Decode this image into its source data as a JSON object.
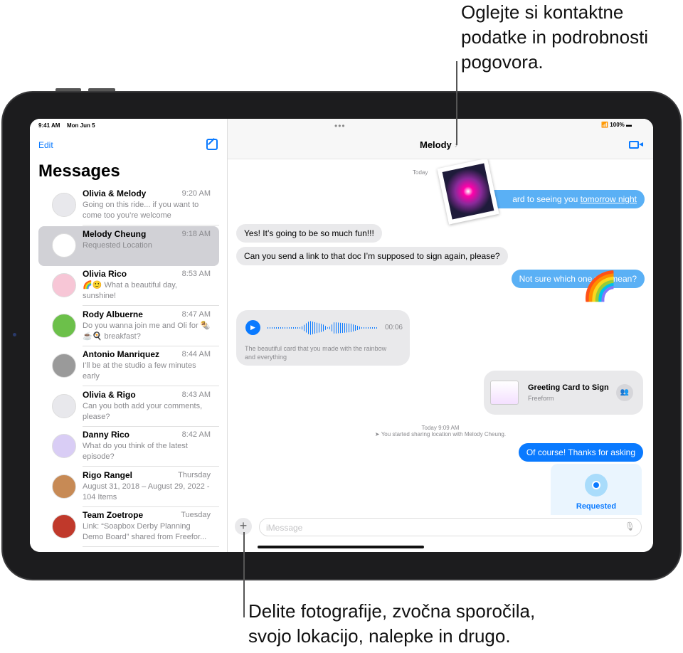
{
  "callouts": {
    "top": [
      "Oglejte si kontaktne",
      "podatke in podrobnosti",
      "pogovora."
    ],
    "bottom": [
      "Delite fotografije, zvočna sporočila,",
      "svojo lokacijo, nalepke in drugo."
    ]
  },
  "status": {
    "time": "9:41 AM",
    "date": "Mon Jun 5",
    "battery": "100%"
  },
  "sidebar": {
    "edit": "Edit",
    "title": "Messages",
    "items": [
      {
        "name": "Olivia & Melody",
        "time": "9:20 AM",
        "preview": "Going on this ride... if you want to come too you’re welcome",
        "avatar": "#e8e8ec"
      },
      {
        "name": "Melody Cheung",
        "time": "9:18 AM",
        "preview": "Requested Location",
        "avatar": "#ffffff",
        "selected": true
      },
      {
        "name": "Olivia Rico",
        "time": "8:53 AM",
        "preview": "🌈🙂 What a beautiful day, sunshine!",
        "avatar": "#f7c6d6"
      },
      {
        "name": "Rody Albuerne",
        "time": "8:47 AM",
        "preview": "Do you wanna join me and Oli for 🌯☕🍳 breakfast?",
        "avatar": "#6cc04a"
      },
      {
        "name": "Antonio Manriquez",
        "time": "8:44 AM",
        "preview": "I’ll be at the studio a few minutes early",
        "avatar": "#9a9a9a"
      },
      {
        "name": "Olivia & Rigo",
        "time": "8:43 AM",
        "preview": "Can you both add your comments, please?",
        "avatar": "#e8e8ec"
      },
      {
        "name": "Danny Rico",
        "time": "8:42 AM",
        "preview": "What do you think of the latest episode?",
        "avatar": "#d9cdf5"
      },
      {
        "name": "Rigo Rangel",
        "time": "Thursday",
        "preview": "August 31, 2018 – August 29, 2022 - 104 Items",
        "avatar": "#c78a55"
      },
      {
        "name": "Team Zoetrope",
        "time": "Tuesday",
        "preview": "Link: “Soapbox Derby Planning Demo Board” shared from Freefor...",
        "avatar": "#c0392b"
      }
    ]
  },
  "chat": {
    "contact": "Melody",
    "day": "Today",
    "messages": [
      {
        "text": "ard to seeing you ",
        "link": "tomorrow night"
      },
      {
        "text": "Yes! It’s going to be so much fun!!!"
      },
      {
        "text": "Can you send a link to that doc I’m supposed to sign again, please?"
      },
      {
        "text": "Not sure which one you mean?"
      },
      {
        "audio_duration": "00:06",
        "transcript": "The beautiful card that you made with the rainbow and everything"
      },
      {
        "card_title": "Greeting Card to Sign",
        "card_app": "Freeform"
      },
      {
        "text": "Of course! Thanks for asking"
      },
      {
        "location": "Requested"
      }
    ],
    "timestamp": "Today 9:09 AM",
    "location_notice": "You started sharing location with Melody Cheung.",
    "input_placeholder": "iMessage"
  },
  "colors": {
    "accent": "#0a7aff",
    "outgoing": "#5ab0f5",
    "incoming": "#e9e9eb"
  }
}
